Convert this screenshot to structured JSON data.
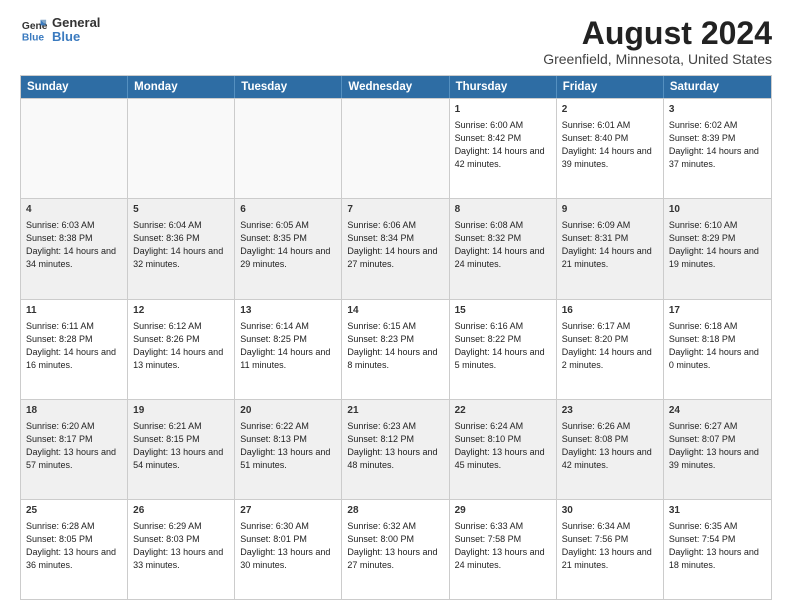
{
  "header": {
    "title": "August 2024",
    "subtitle": "Greenfield, Minnesota, United States",
    "logo_general": "General",
    "logo_blue": "Blue"
  },
  "days_of_week": [
    "Sunday",
    "Monday",
    "Tuesday",
    "Wednesday",
    "Thursday",
    "Friday",
    "Saturday"
  ],
  "rows": [
    [
      {
        "day": "",
        "text": "",
        "empty": true
      },
      {
        "day": "",
        "text": "",
        "empty": true
      },
      {
        "day": "",
        "text": "",
        "empty": true
      },
      {
        "day": "",
        "text": "",
        "empty": true
      },
      {
        "day": "1",
        "text": "Sunrise: 6:00 AM\nSunset: 8:42 PM\nDaylight: 14 hours and 42 minutes."
      },
      {
        "day": "2",
        "text": "Sunrise: 6:01 AM\nSunset: 8:40 PM\nDaylight: 14 hours and 39 minutes."
      },
      {
        "day": "3",
        "text": "Sunrise: 6:02 AM\nSunset: 8:39 PM\nDaylight: 14 hours and 37 minutes."
      }
    ],
    [
      {
        "day": "4",
        "text": "Sunrise: 6:03 AM\nSunset: 8:38 PM\nDaylight: 14 hours and 34 minutes.",
        "shaded": true
      },
      {
        "day": "5",
        "text": "Sunrise: 6:04 AM\nSunset: 8:36 PM\nDaylight: 14 hours and 32 minutes.",
        "shaded": true
      },
      {
        "day": "6",
        "text": "Sunrise: 6:05 AM\nSunset: 8:35 PM\nDaylight: 14 hours and 29 minutes.",
        "shaded": true
      },
      {
        "day": "7",
        "text": "Sunrise: 6:06 AM\nSunset: 8:34 PM\nDaylight: 14 hours and 27 minutes.",
        "shaded": true
      },
      {
        "day": "8",
        "text": "Sunrise: 6:08 AM\nSunset: 8:32 PM\nDaylight: 14 hours and 24 minutes.",
        "shaded": true
      },
      {
        "day": "9",
        "text": "Sunrise: 6:09 AM\nSunset: 8:31 PM\nDaylight: 14 hours and 21 minutes.",
        "shaded": true
      },
      {
        "day": "10",
        "text": "Sunrise: 6:10 AM\nSunset: 8:29 PM\nDaylight: 14 hours and 19 minutes.",
        "shaded": true
      }
    ],
    [
      {
        "day": "11",
        "text": "Sunrise: 6:11 AM\nSunset: 8:28 PM\nDaylight: 14 hours and 16 minutes."
      },
      {
        "day": "12",
        "text": "Sunrise: 6:12 AM\nSunset: 8:26 PM\nDaylight: 14 hours and 13 minutes."
      },
      {
        "day": "13",
        "text": "Sunrise: 6:14 AM\nSunset: 8:25 PM\nDaylight: 14 hours and 11 minutes."
      },
      {
        "day": "14",
        "text": "Sunrise: 6:15 AM\nSunset: 8:23 PM\nDaylight: 14 hours and 8 minutes."
      },
      {
        "day": "15",
        "text": "Sunrise: 6:16 AM\nSunset: 8:22 PM\nDaylight: 14 hours and 5 minutes."
      },
      {
        "day": "16",
        "text": "Sunrise: 6:17 AM\nSunset: 8:20 PM\nDaylight: 14 hours and 2 minutes."
      },
      {
        "day": "17",
        "text": "Sunrise: 6:18 AM\nSunset: 8:18 PM\nDaylight: 14 hours and 0 minutes."
      }
    ],
    [
      {
        "day": "18",
        "text": "Sunrise: 6:20 AM\nSunset: 8:17 PM\nDaylight: 13 hours and 57 minutes.",
        "shaded": true
      },
      {
        "day": "19",
        "text": "Sunrise: 6:21 AM\nSunset: 8:15 PM\nDaylight: 13 hours and 54 minutes.",
        "shaded": true
      },
      {
        "day": "20",
        "text": "Sunrise: 6:22 AM\nSunset: 8:13 PM\nDaylight: 13 hours and 51 minutes.",
        "shaded": true
      },
      {
        "day": "21",
        "text": "Sunrise: 6:23 AM\nSunset: 8:12 PM\nDaylight: 13 hours and 48 minutes.",
        "shaded": true
      },
      {
        "day": "22",
        "text": "Sunrise: 6:24 AM\nSunset: 8:10 PM\nDaylight: 13 hours and 45 minutes.",
        "shaded": true
      },
      {
        "day": "23",
        "text": "Sunrise: 6:26 AM\nSunset: 8:08 PM\nDaylight: 13 hours and 42 minutes.",
        "shaded": true
      },
      {
        "day": "24",
        "text": "Sunrise: 6:27 AM\nSunset: 8:07 PM\nDaylight: 13 hours and 39 minutes.",
        "shaded": true
      }
    ],
    [
      {
        "day": "25",
        "text": "Sunrise: 6:28 AM\nSunset: 8:05 PM\nDaylight: 13 hours and 36 minutes."
      },
      {
        "day": "26",
        "text": "Sunrise: 6:29 AM\nSunset: 8:03 PM\nDaylight: 13 hours and 33 minutes."
      },
      {
        "day": "27",
        "text": "Sunrise: 6:30 AM\nSunset: 8:01 PM\nDaylight: 13 hours and 30 minutes."
      },
      {
        "day": "28",
        "text": "Sunrise: 6:32 AM\nSunset: 8:00 PM\nDaylight: 13 hours and 27 minutes."
      },
      {
        "day": "29",
        "text": "Sunrise: 6:33 AM\nSunset: 7:58 PM\nDaylight: 13 hours and 24 minutes."
      },
      {
        "day": "30",
        "text": "Sunrise: 6:34 AM\nSunset: 7:56 PM\nDaylight: 13 hours and 21 minutes."
      },
      {
        "day": "31",
        "text": "Sunrise: 6:35 AM\nSunset: 7:54 PM\nDaylight: 13 hours and 18 minutes."
      }
    ]
  ]
}
